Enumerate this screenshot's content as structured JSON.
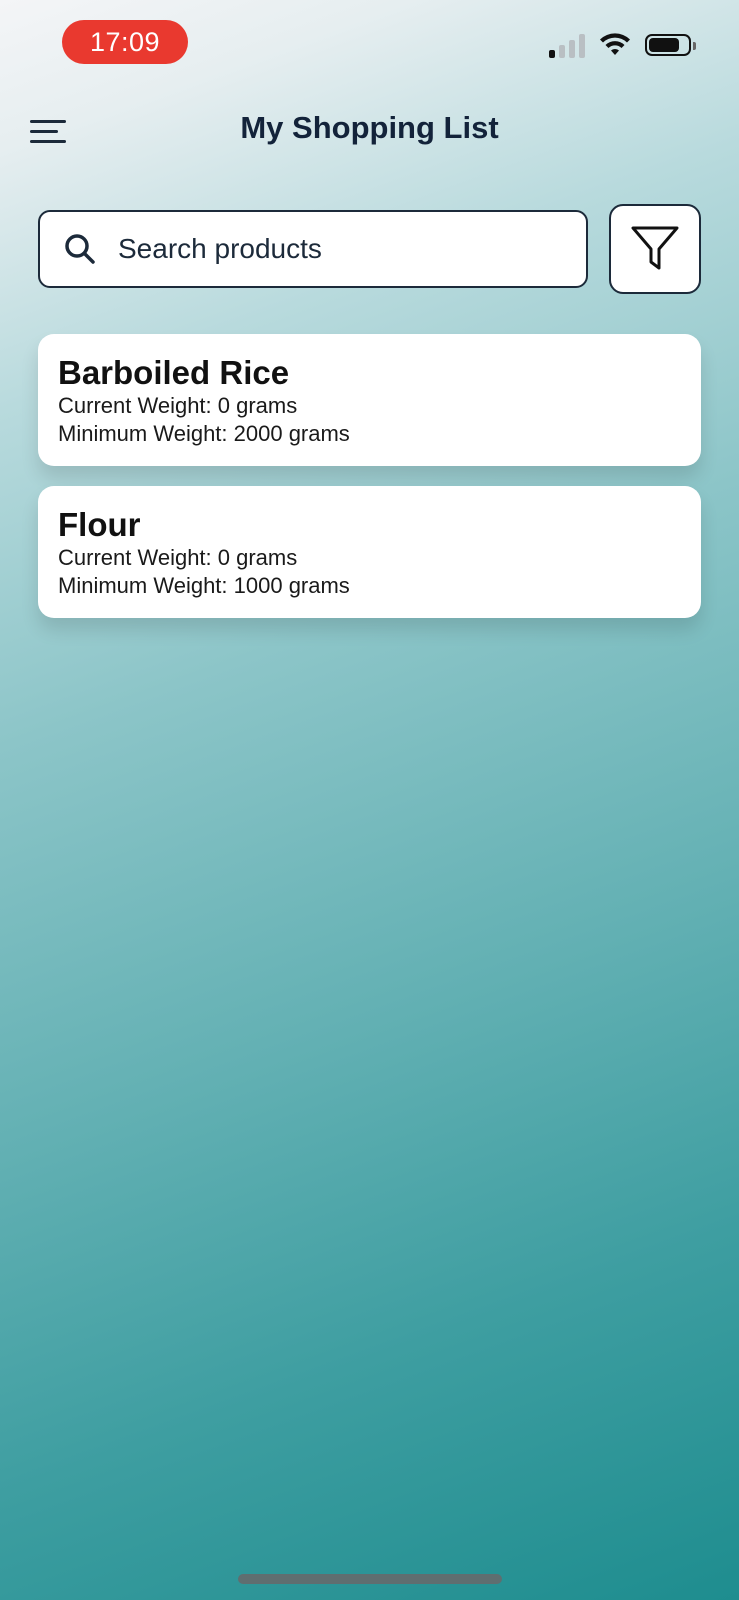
{
  "status_bar": {
    "time": "17:09",
    "signal_icon": "cellular-signal-icon",
    "wifi_icon": "wifi-icon",
    "battery_icon": "battery-icon",
    "battery_level": 0.8,
    "time_pill_color": "#e9392f"
  },
  "header": {
    "title": "My Shopping List",
    "menu_icon": "hamburger-menu-icon"
  },
  "search": {
    "placeholder": "Search products",
    "value": "",
    "icon": "search-icon"
  },
  "filter": {
    "icon": "filter-funnel-icon"
  },
  "products": [
    {
      "name": "Barboiled Rice",
      "current_weight": "Current Weight: 0 grams",
      "minimum_weight": "Minimum Weight: 2000 grams"
    },
    {
      "name": "Flour",
      "current_weight": "Current Weight: 0 grams",
      "minimum_weight": "Minimum Weight: 1000 grams"
    }
  ],
  "colors": {
    "text_dark": "#13233a",
    "background_top": "#f4f5f7",
    "background_bottom": "#1e8d8f"
  }
}
